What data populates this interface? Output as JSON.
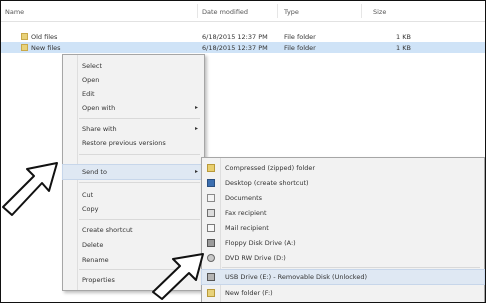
{
  "columns": {
    "name": "Name",
    "date_modified": "Date modified",
    "type": "Type",
    "size": "Size"
  },
  "rows": [
    {
      "name": "Old files",
      "date": "6/18/2015 12:37 PM",
      "type": "File folder",
      "size": "1 KB",
      "selected": false
    },
    {
      "name": "New files",
      "date": "6/18/2015 12:37 PM",
      "type": "File folder",
      "size": "1 KB",
      "selected": true
    }
  ],
  "context_menu": {
    "items_group1": [
      "Select",
      "Open",
      "Edit"
    ],
    "open_with": "Open with",
    "items_group2": [
      "Share with",
      "Restore previous versions"
    ],
    "send_to": "Send to",
    "items_group3": [
      "Cut",
      "Copy"
    ],
    "items_group4": [
      "Create shortcut",
      "Delete",
      "Rename"
    ],
    "properties": "Properties"
  },
  "submenu": {
    "items": [
      "Compressed (zipped) folder",
      "Desktop (create shortcut)",
      "Documents",
      "Fax recipient",
      "Mail recipient",
      "Floppy Disk Drive (A:)",
      "DVD RW Drive (D:)",
      "USB Drive (E:) - Removable Disk (Unlocked)",
      "New folder (F:)"
    ]
  }
}
